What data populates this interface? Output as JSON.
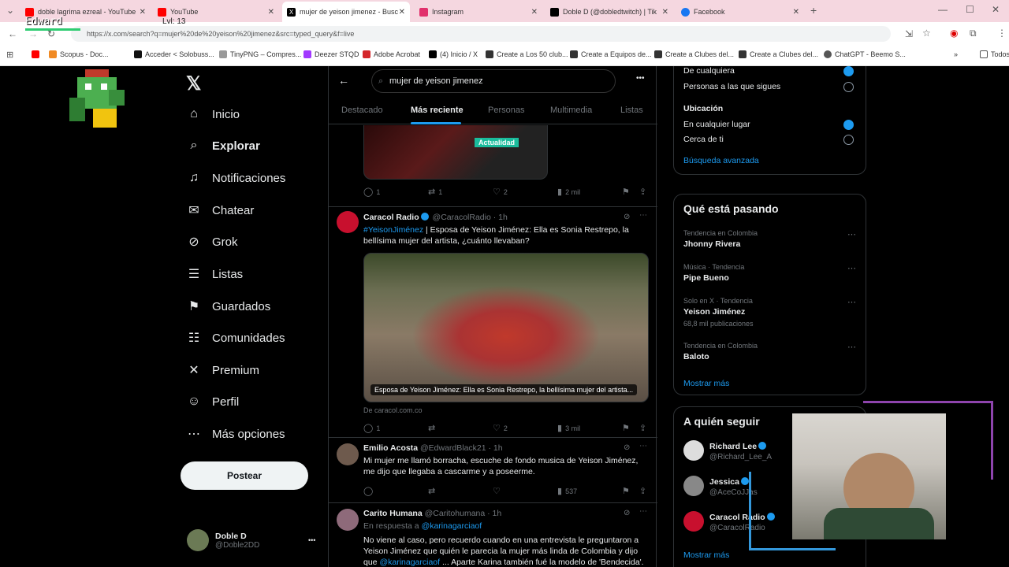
{
  "browser": {
    "tabs": [
      {
        "label": "doble lagrima ezreal - YouTube",
        "color": "#ff0000"
      },
      {
        "label": "YouTube",
        "color": "#ff0000"
      },
      {
        "label": "mujer de yeison jimenez - Busc",
        "color": "#000000"
      },
      {
        "label": "Instagram",
        "color": "#e1306c"
      },
      {
        "label": "Doble D (@dobledtwitch) | Tik",
        "color": "#000000"
      },
      {
        "label": "Facebook",
        "color": "#1877f2"
      }
    ],
    "new_tab": "+",
    "url": "https://x.com/search?q=mujer%20de%20yeison%20jimenez&src=typed_query&f=live",
    "bookmarks": [
      "Scopus - Doc...",
      "Acceder < Solobuss...",
      "TinyPNG – Compres...",
      "Deezer STQD",
      "Adobe Acrobat",
      "(4) Inicio / X",
      "Create a Los 50 club...",
      "Create a Equipos de...",
      "Create a Clubes del...",
      "Create a Clubes del...",
      "ChatGPT - Beemo S..."
    ],
    "bookmarks_overflow": "»",
    "all_bookmarks": "Todos"
  },
  "overlay": {
    "name": "Edward",
    "level": "Lvl: 13"
  },
  "sidebar": {
    "items": [
      {
        "label": "Inicio",
        "icon": "⌂"
      },
      {
        "label": "Explorar",
        "icon": "⌕"
      },
      {
        "label": "Notificaciones",
        "icon": "♫"
      },
      {
        "label": "Chatear",
        "icon": "✉"
      },
      {
        "label": "Grok",
        "icon": "⊘"
      },
      {
        "label": "Listas",
        "icon": "☰"
      },
      {
        "label": "Guardados",
        "icon": "⚑"
      },
      {
        "label": "Comunidades",
        "icon": "☷"
      },
      {
        "label": "Premium",
        "icon": "✕"
      },
      {
        "label": "Perfil",
        "icon": "☺"
      },
      {
        "label": "Más opciones",
        "icon": "⋯"
      }
    ],
    "post_button": "Postear",
    "profile": {
      "name": "Doble D",
      "handle": "@Doble2DD",
      "more": "•••"
    }
  },
  "search": {
    "query": "mujer de yeison jimenez",
    "more": "•••",
    "tabs": [
      "Destacado",
      "Más reciente",
      "Personas",
      "Multimedia",
      "Listas"
    ]
  },
  "tweets": {
    "t0": {
      "badge": "Actualidad",
      "replies": "1",
      "retweets": "1",
      "likes": "2",
      "views": "2 mil"
    },
    "t1": {
      "name": "Caracol Radio",
      "handle": "@CaracolRadio · 1h",
      "hashtag": "#YeisonJiménez",
      "text": "| Esposa de Yeison Jiménez: Ella es Sonia Restrepo, la bellísima mujer del artista, ¿cuánto llevaban?",
      "image_caption": "Esposa de Yeison Jiménez: Ella es Sonia Restrepo, la bellísima mujer del artista...",
      "source": "De caracol.com.co",
      "replies": "1",
      "retweets": "",
      "likes": "2",
      "views": "3 mil"
    },
    "t2": {
      "name": "Emilio Acosta",
      "handle": "@EdwardBlack21 · 1h",
      "text": "Mi mujer me llamó borracha, escuche de fondo musica de Yeison Jiménez, me dijo que llegaba a cascarme y a poseerme.",
      "replies": "",
      "retweets": "",
      "likes": "",
      "views": "537"
    },
    "t3": {
      "name": "Carito Humana",
      "handle": "@Caritohumana · 1h",
      "reply_prefix": "En respuesta a",
      "reply_to": "@karinagarciaof",
      "text": "No viene al caso, pero recuerdo cuando en una entrevista le preguntaron a Yeison Jiménez que quién le parecia la mujer más linda de Colombia y dijo que",
      "text_link": "@karinagarciaof",
      "text_tail": "... Aparte Karina también fué la modelo de 'Bendecida'."
    }
  },
  "filters": {
    "options_people": [
      "De cualquiera",
      "Personas a las que sigues"
    ],
    "location_title": "Ubicación",
    "options_location": [
      "En cualquier lugar",
      "Cerca de ti"
    ],
    "advanced": "Búsqueda avanzada"
  },
  "trends": {
    "title": "Qué está pasando",
    "items": [
      {
        "meta": "Tendencia en Colombia",
        "name": "Jhonny Rivera",
        "count": ""
      },
      {
        "meta": "Música · Tendencia",
        "name": "Pipe Bueno",
        "count": ""
      },
      {
        "meta": "Solo en X · Tendencia",
        "name": "Yeison Jiménez",
        "count": "68,8 mil publicaciones"
      },
      {
        "meta": "Tendencia en Colombia",
        "name": "Baloto",
        "count": ""
      }
    ],
    "more": "Mostrar más"
  },
  "follow": {
    "title": "A quién seguir",
    "items": [
      {
        "name": "Richard Lee",
        "handle": "@Richard_Lee_A"
      },
      {
        "name": "Jessica",
        "handle": "@AceCoJJas"
      },
      {
        "name": "Caracol Radio",
        "handle": "@CaracolRadio"
      }
    ],
    "more": "Mostrar más"
  },
  "colors": {
    "accent": "#1d9bf0",
    "background": "#000000",
    "border": "#2f3336",
    "muted": "#71767b"
  }
}
